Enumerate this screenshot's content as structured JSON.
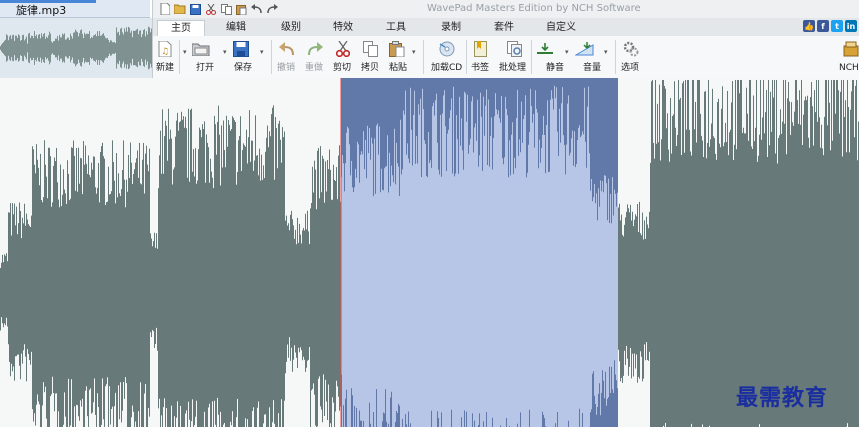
{
  "file_tab": {
    "name": "旋律.mp3"
  },
  "window": {
    "title": "WavePad Masters Edition by NCH Software"
  },
  "quick_access": [
    "new-icon",
    "open-icon",
    "save-icon",
    "cut-icon",
    "copy-icon",
    "paste-icon",
    "undo-icon",
    "redo-icon"
  ],
  "tabs": [
    {
      "label": "主页",
      "active": true
    },
    {
      "label": "编辑"
    },
    {
      "label": "级别"
    },
    {
      "label": "特效"
    },
    {
      "label": "工具"
    },
    {
      "label": "录制"
    },
    {
      "label": "套件"
    },
    {
      "label": "自定义"
    }
  ],
  "social": [
    {
      "icon": "thumbs-up-icon",
      "color": "#3b5998",
      "glyph": "👍"
    },
    {
      "icon": "facebook-icon",
      "color": "#3b5998",
      "glyph": "f"
    },
    {
      "icon": "twitter-icon",
      "color": "#1da1f2",
      "glyph": "t"
    },
    {
      "icon": "linkedin-icon",
      "color": "#0077b5",
      "glyph": "in"
    }
  ],
  "toolbar": {
    "new": "新建",
    "open": "打开",
    "save": "保存",
    "undo": "撤销",
    "redo": "重做",
    "cut": "剪切",
    "copy": "拷贝",
    "paste": "粘贴",
    "load_cd": "加载CD",
    "bookmark": "书签",
    "batch": "批处理",
    "silence": "静音",
    "volume": "音量",
    "options": "选项",
    "nch": "NCH套"
  },
  "waveform": {
    "color": "#677979",
    "selection_color": "#6079a8",
    "selection_wave_color": "#b7c6e6",
    "cursor_color": "#e24a4a",
    "selection": {
      "start": 0.397,
      "end": 0.719
    }
  },
  "overview": {
    "color": "#7f9191"
  },
  "watermark": "最需教育"
}
